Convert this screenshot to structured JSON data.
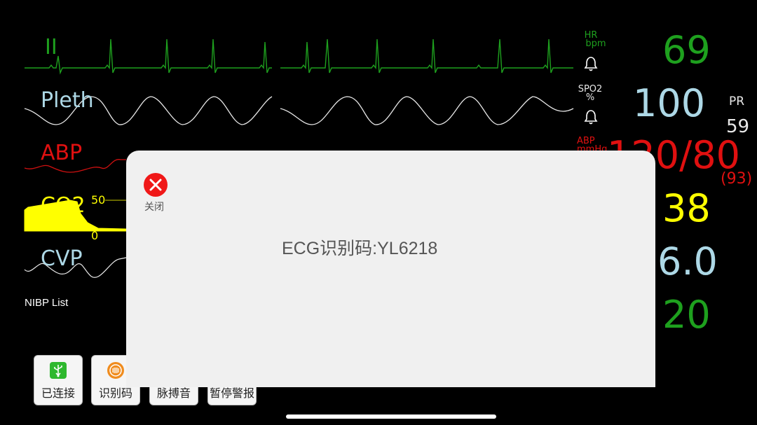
{
  "waveforms": {
    "ecg_label": "II",
    "pleth_label": "Pleth",
    "abp_label": "ABP",
    "co2_label": "CO2",
    "co2_scale_top": "50",
    "co2_scale_bottom": "0",
    "cvp_label": "CVP"
  },
  "params": {
    "hr": {
      "name": "HR",
      "unit": "bpm",
      "value": "69",
      "color": "#1ea01e"
    },
    "spo2": {
      "name": "SPO2",
      "unit": "%",
      "value": "100",
      "color": "#add8e6"
    },
    "pr": {
      "name": "PR",
      "value": "59"
    },
    "abp": {
      "name": "ABP",
      "unit": "mmHg",
      "value": "120/80",
      "mean": "(93)",
      "color": "#e01010"
    },
    "co2": {
      "value": "38",
      "color": "#ffff00"
    },
    "cvp": {
      "value": "6.0",
      "color": "#add8e6"
    },
    "rr": {
      "value": "20",
      "color": "#1ea01e"
    }
  },
  "nibp_list_label": "NIBP List",
  "dialog": {
    "close_label": "关闭",
    "ecg_code": "ECG识别码:YL6218"
  },
  "toolbar": {
    "connected_label": "已连接",
    "id_code_label": "识别码",
    "pulse_sound_label": "脉搏音",
    "pause_alarm_label": "暂停警报"
  },
  "icons": {
    "alarm": "bell-icon",
    "close": "close-icon",
    "usb": "usb-icon",
    "id_code": "id-code-icon"
  }
}
